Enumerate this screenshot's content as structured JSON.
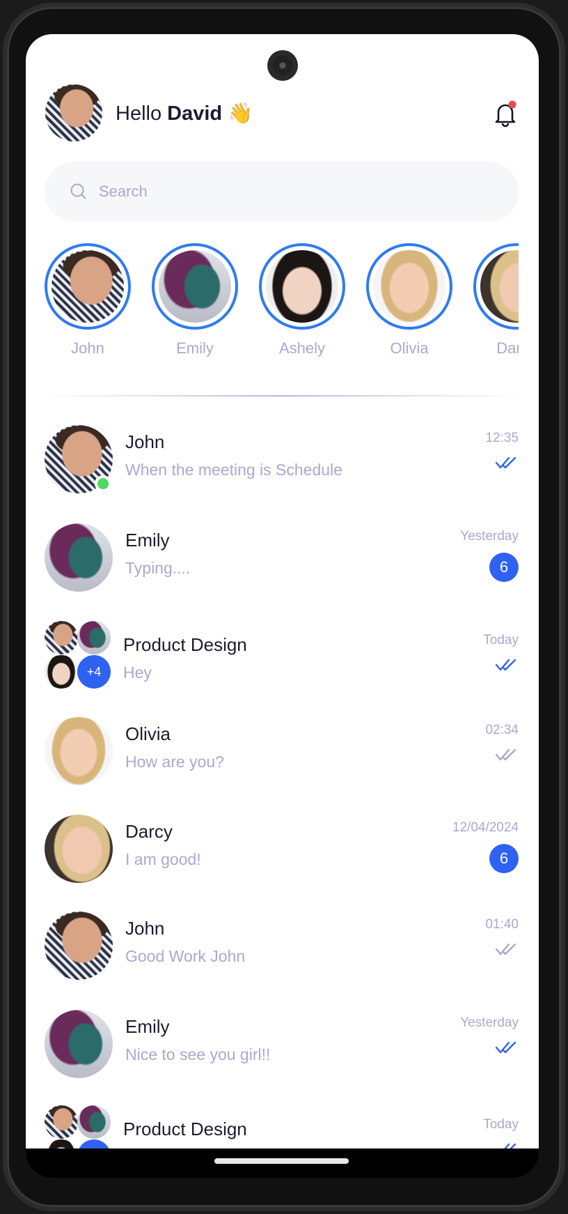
{
  "header": {
    "greeting": "Hello",
    "user_name": "David",
    "wave_emoji": "👋",
    "has_notification": true
  },
  "search": {
    "placeholder": "Search",
    "value": ""
  },
  "stories": [
    {
      "name": "John",
      "photo": "john"
    },
    {
      "name": "Emily",
      "photo": "emily"
    },
    {
      "name": "Ashely",
      "photo": "ashely"
    },
    {
      "name": "Olivia",
      "photo": "olivia"
    },
    {
      "name": "Darcy",
      "photo": "darcy"
    }
  ],
  "chats": [
    {
      "name": "John",
      "message": "When the meeting is Schedule",
      "time": "12:35",
      "status": "read",
      "online": true,
      "photo": "john"
    },
    {
      "name": "Emily",
      "message": "Typing....",
      "time": "Yesterday",
      "unread": "6",
      "photo": "emily"
    },
    {
      "name": "Product Design",
      "message": "Hey",
      "time": "Today",
      "status": "read",
      "group": true,
      "group_more": "+4"
    },
    {
      "name": "Olivia",
      "message": "How are you?",
      "time": "02:34",
      "status": "delivered",
      "photo": "olivia"
    },
    {
      "name": "Darcy",
      "message": "I am good!",
      "time": "12/04/2024",
      "unread": "6",
      "photo": "darcy"
    },
    {
      "name": "John",
      "message": "Good Work John",
      "time": "01:40",
      "status": "delivered",
      "photo": "john"
    },
    {
      "name": "Emily",
      "message": "Nice to see you girl!!",
      "time": "Yesterday",
      "status": "read",
      "photo": "emily"
    },
    {
      "name": "Product Design",
      "message": "",
      "time": "Today",
      "status": "read",
      "group": true,
      "group_more": ""
    }
  ],
  "colors": {
    "accent": "#2f62f0",
    "story_ring": "#2f7bf0",
    "online": "#4cd964",
    "read_check": "#2f62f0",
    "delivered_check": "#a9a8cf",
    "notification_dot": "#e94b4b",
    "text_primary": "#1c1c30",
    "text_secondary": "#a9a8cf"
  }
}
